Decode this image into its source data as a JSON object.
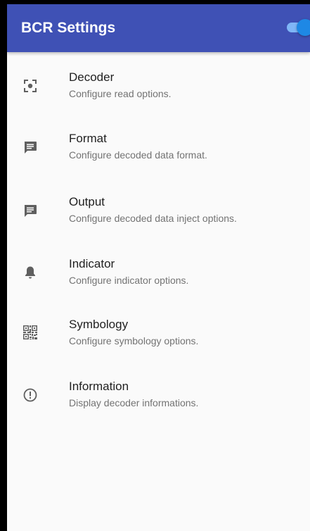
{
  "app_bar": {
    "title": "BCR Settings",
    "toggle_on": true,
    "toggle_color": "#1e88e5",
    "bar_color": "#3f51b5"
  },
  "settings": {
    "items": [
      {
        "title": "Decoder",
        "subtitle": "Configure read options.",
        "icon": "scan-focus-icon"
      },
      {
        "title": "Format",
        "subtitle": "Configure decoded data format.",
        "icon": "message-icon"
      },
      {
        "title": "Output",
        "subtitle": "Configure decoded data inject options.",
        "icon": "message-icon"
      },
      {
        "title": "Indicator",
        "subtitle": "Configure indicator options.",
        "icon": "bell-icon"
      },
      {
        "title": "Symbology",
        "subtitle": "Configure symbology options.",
        "icon": "qr-code-icon"
      },
      {
        "title": "Information",
        "subtitle": "Display decoder informations.",
        "icon": "info-alert-icon"
      }
    ]
  }
}
